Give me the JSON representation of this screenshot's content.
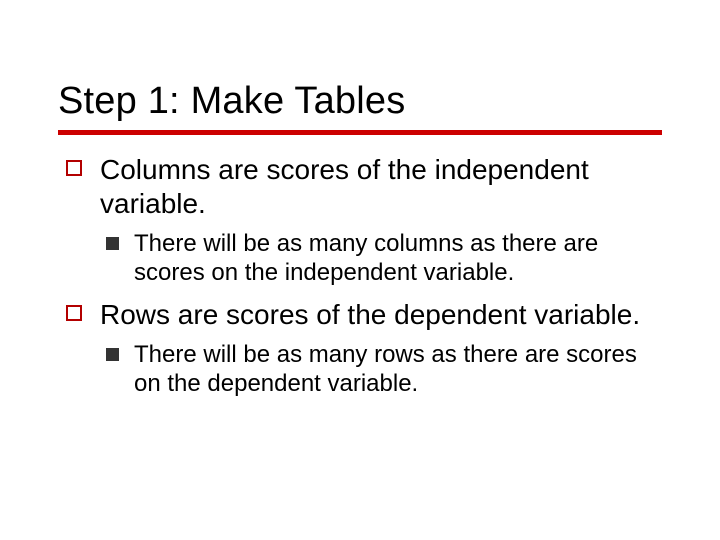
{
  "slide": {
    "title": "Step 1: Make Tables",
    "bullets": [
      {
        "text": "Columns are scores of the independent variable.",
        "sub": [
          "There will be as many columns as there are scores on the independent variable."
        ]
      },
      {
        "text": "Rows are scores of the dependent variable.",
        "sub": [
          "There will be as many rows as there are scores on the dependent variable."
        ]
      }
    ],
    "accent_color": "#cc0000"
  }
}
